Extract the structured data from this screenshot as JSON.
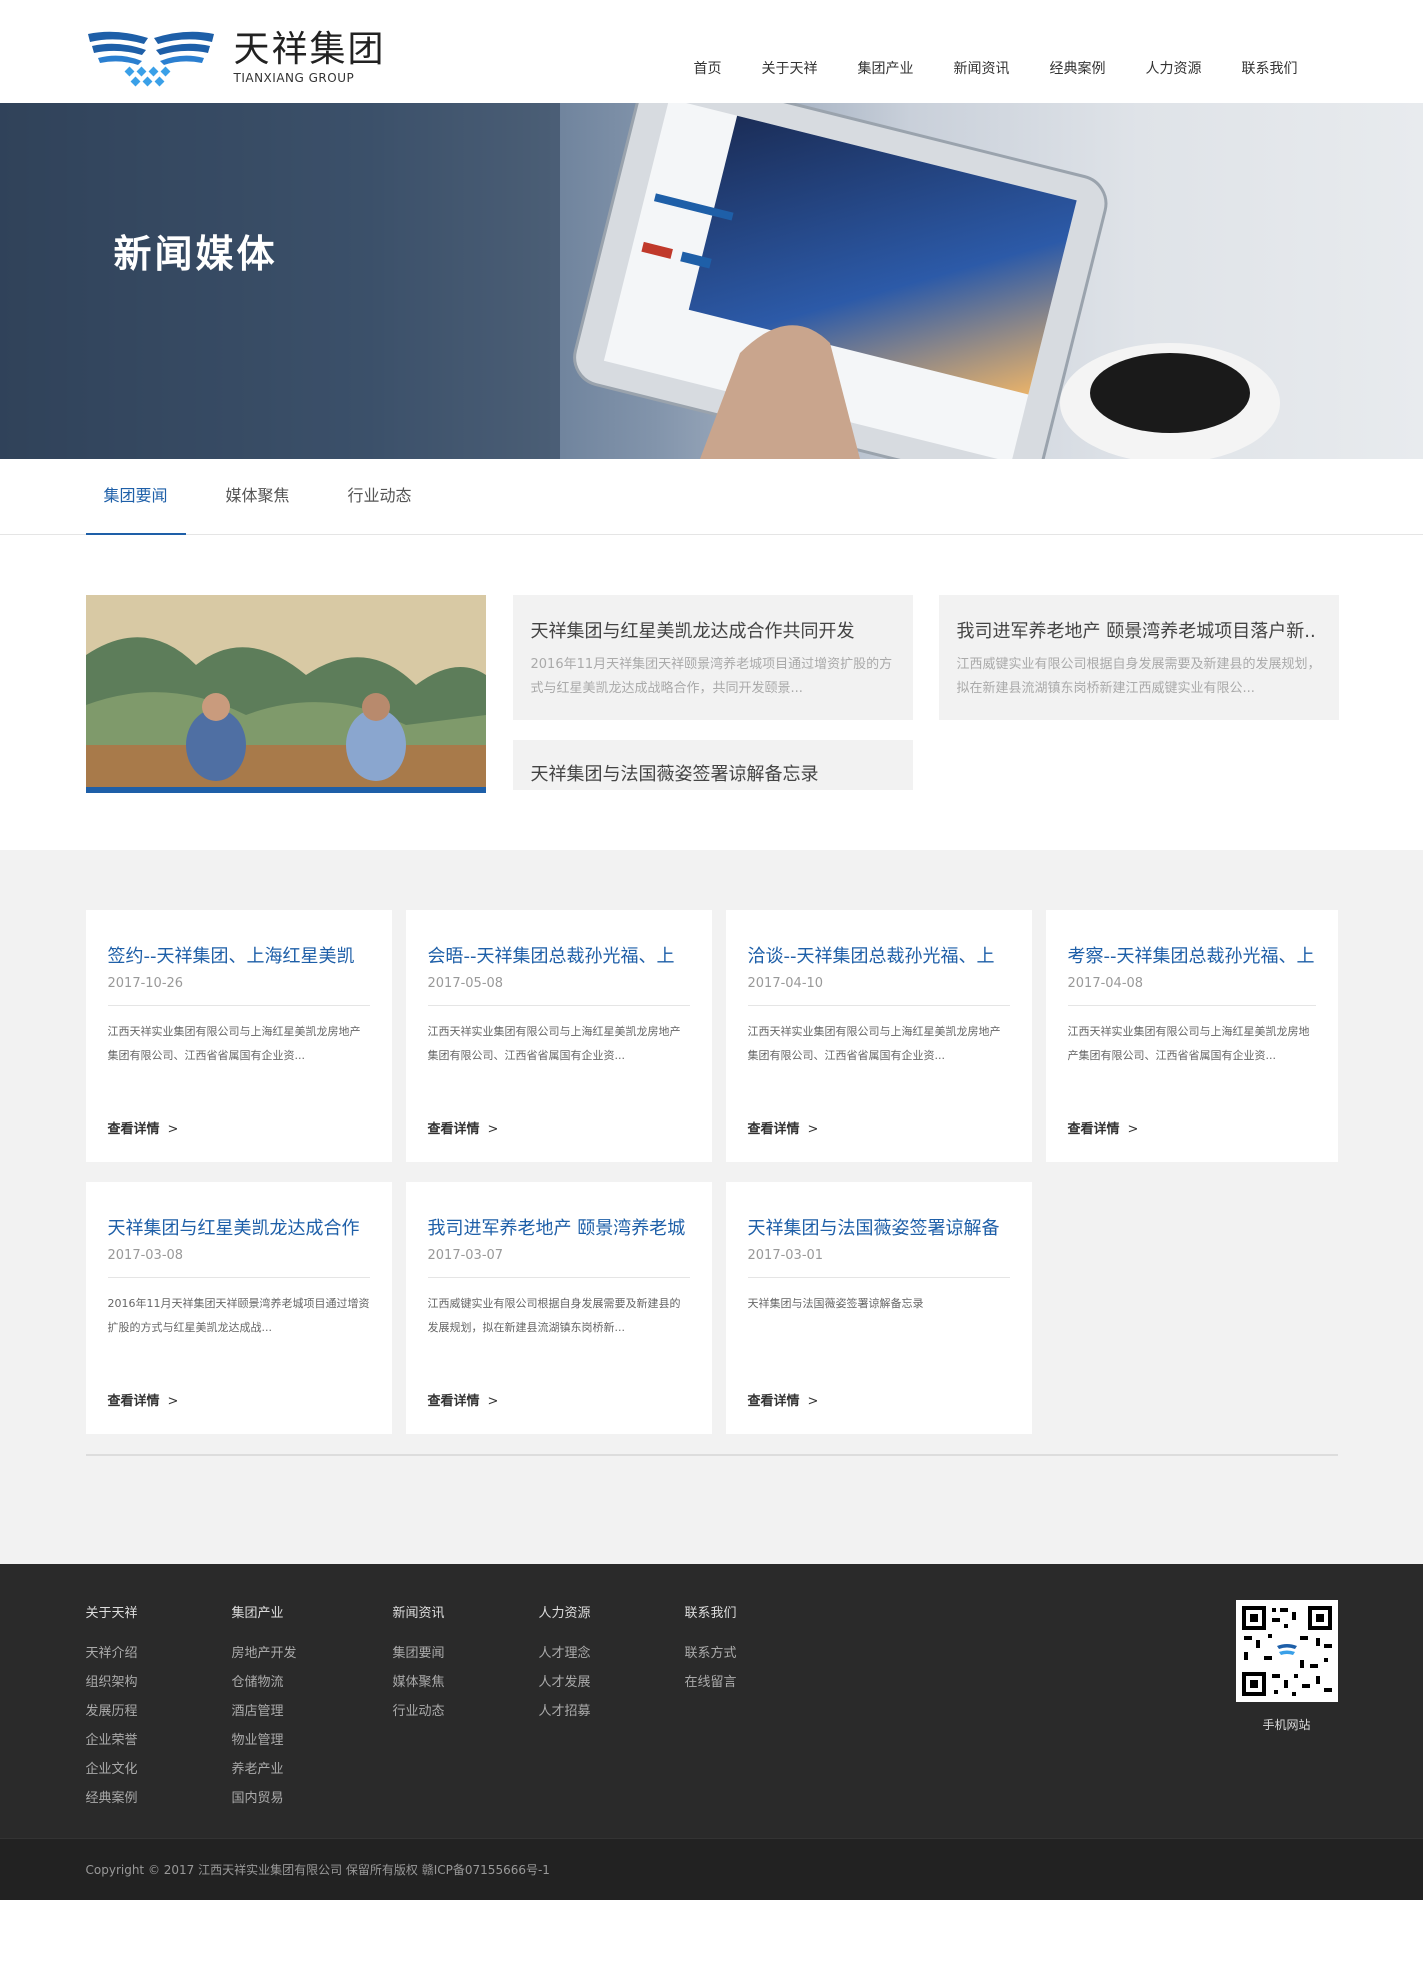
{
  "logo": {
    "cn": "天祥集团",
    "en": "TIANXIANG GROUP"
  },
  "nav": [
    "首页",
    "关于天祥",
    "集团产业",
    "新闻资讯",
    "经典案例",
    "人力资源",
    "联系我们"
  ],
  "banner": {
    "title": "新闻媒体"
  },
  "tabs": [
    "集团要闻",
    "媒体聚焦",
    "行业动态"
  ],
  "featured": [
    {
      "title": "天祥集团与红星美凯龙达成合作共同开发",
      "desc": "2016年11月天祥集团天祥颐景湾养老城项目通过增资扩股的方式与红星美凯龙达成战略合作，共同开发颐景..."
    },
    {
      "title": "我司进军养老地产 颐景湾养老城项目落户新..",
      "desc": "江西威键实业有限公司根据自身发展需要及新建县的发展规划，拟在新建县流湖镇东岗桥新建江西威键实业有限公..."
    },
    {
      "title": "天祥集团与法国薇姿签署谅解备忘录",
      "desc": ""
    }
  ],
  "news": [
    {
      "title": "签约--天祥集团、上海红星美凯",
      "date": "2017-10-26",
      "desc": "江西天祥实业集团有限公司与上海红星美凯龙房地产集团有限公司、江西省省属国有企业资..."
    },
    {
      "title": "会晤--天祥集团总裁孙光福、上",
      "date": "2017-05-08",
      "desc": "江西天祥实业集团有限公司与上海红星美凯龙房地产集团有限公司、江西省省属国有企业资..."
    },
    {
      "title": "洽谈--天祥集团总裁孙光福、上",
      "date": "2017-04-10",
      "desc": "江西天祥实业集团有限公司与上海红星美凯龙房地产集团有限公司、江西省省属国有企业资..."
    },
    {
      "title": "考察--天祥集团总裁孙光福、上",
      "date": "2017-04-08",
      "desc": "江西天祥实业集团有限公司与上海红星美凯龙房地产集团有限公司、江西省省属国有企业资..."
    },
    {
      "title": "天祥集团与红星美凯龙达成合作",
      "date": "2017-03-08",
      "desc": "2016年11月天祥集团天祥颐景湾养老城项目通过增资扩股的方式与红星美凯龙达成战..."
    },
    {
      "title": "我司进军养老地产 颐景湾养老城",
      "date": "2017-03-07",
      "desc": "江西威键实业有限公司根据自身发展需要及新建县的发展规划，拟在新建县流湖镇东岗桥新..."
    },
    {
      "title": "天祥集团与法国薇姿签署谅解备",
      "date": "2017-03-01",
      "desc": "天祥集团与法国薇姿签署谅解备忘录"
    }
  ],
  "more_label": "查看详情",
  "more_arrow": ">",
  "footer": {
    "cols": [
      {
        "heading": "关于天祥",
        "links": [
          "天祥介绍",
          "组织架构",
          "发展历程",
          "企业荣誉",
          "企业文化",
          "经典案例"
        ]
      },
      {
        "heading": "集团产业",
        "links": [
          "房地产开发",
          "仓储物流",
          "酒店管理",
          "物业管理",
          "养老产业",
          "国内贸易"
        ]
      },
      {
        "heading": "新闻资讯",
        "links": [
          "集团要闻",
          "媒体聚焦",
          "行业动态"
        ]
      },
      {
        "heading": "人力资源",
        "links": [
          "人才理念",
          "人才发展",
          "人才招募"
        ]
      },
      {
        "heading": "联系我们",
        "links": [
          "联系方式",
          "在线留言"
        ]
      }
    ],
    "qr_label": "手机网站",
    "copyright": "Copyright © 2017 江西天祥实业集团有限公司 保留所有版权 赣ICP备07155666号-1"
  },
  "colors": {
    "accent": "#1e5fa8",
    "footer_bg": "#2a2a2a",
    "section_bg": "#f2f2f2"
  }
}
